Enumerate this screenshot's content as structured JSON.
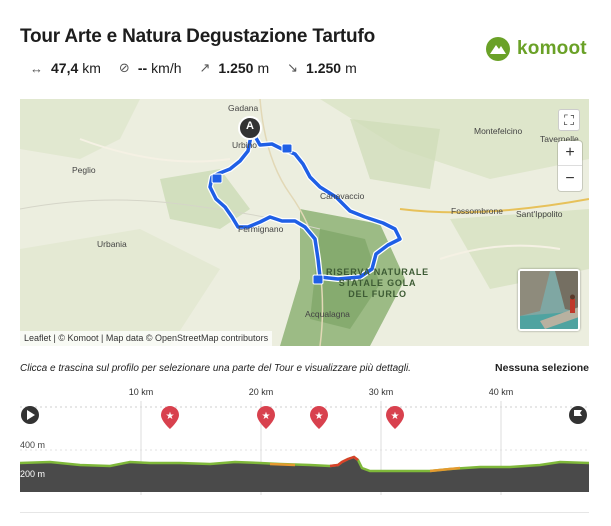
{
  "tour": {
    "title": "Tour Arte e Natura Degustazione Tartufo",
    "distance": "47,4",
    "distance_unit": "km",
    "speed": "--",
    "speed_unit": "km/h",
    "ascent": "1.250",
    "ascent_unit": "m",
    "descent": "1.250",
    "descent_unit": "m"
  },
  "brand": {
    "name": "komoot",
    "color": "#6aa127"
  },
  "map": {
    "places": [
      "Gadana",
      "Urbino",
      "Peglio",
      "Urbania",
      "Montefelcino",
      "Tavernelle",
      "Fossombrone",
      "Sant'Ippolito",
      "Canavaccio",
      "Fermignano",
      "Acqualagna"
    ],
    "reserve_label": [
      "RISERVA NATURALE",
      "STATALE GOLA",
      "DEL FURLO"
    ],
    "start_marker": "A",
    "attribution": "Leaflet | © Komoot | Map data © OpenStreetMap contributors",
    "route_color": "#1f5fe6",
    "controls": {
      "zoom_in": "+",
      "zoom_out": "−",
      "fullscreen": "⛶"
    }
  },
  "profile": {
    "hint": "Clicca e trascina sul profilo per selezionare una parte del Tour e visualizzare più dettagli.",
    "selection": "Nessuna selezione",
    "km_ticks": [
      "10 km",
      "20 km",
      "30 km",
      "40 km"
    ],
    "elevation_labels": [
      "400 m",
      "200 m"
    ]
  }
}
